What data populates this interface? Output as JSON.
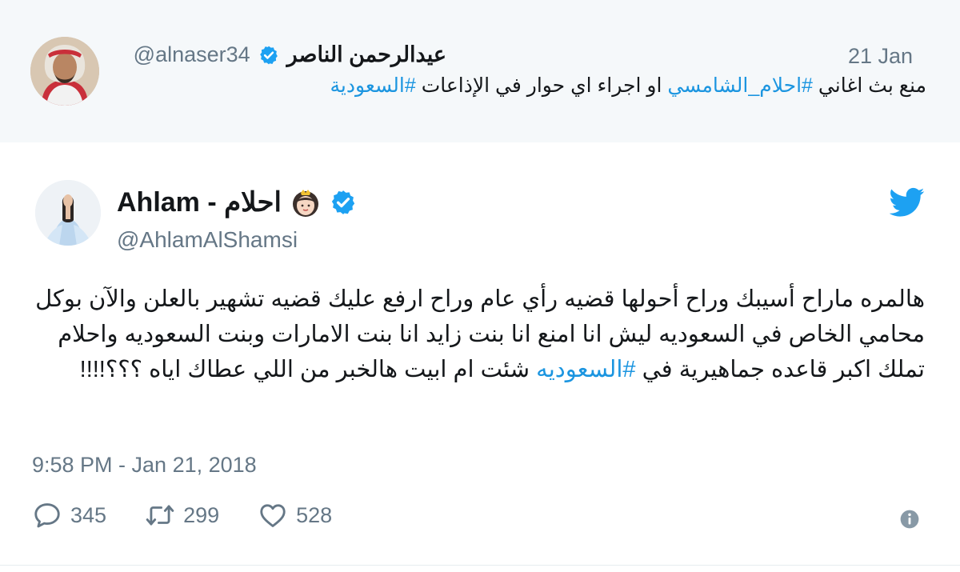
{
  "parent_tweet": {
    "name": "عيدالرحمن الناصر",
    "handle": "@alnaser34",
    "date": "21 Jan",
    "text_part1": "منع بث اغاني ",
    "hashtag1": "#احلام_الشامسي",
    "text_part2": " او اجراء اي حوار في الإذاعات ",
    "hashtag2": "#السعودية"
  },
  "main_tweet": {
    "name": "Ahlam - احلام",
    "handle": "@AhlamAlShamsi",
    "body_part1": "هالمره ماراح أسيبك وراح أحولها قضيه رأي عام وراح ارفع عليك قضيه تشهير بالعلن والآن بوكل محامي الخاص في السعوديه ليش انا امنع انا بنت زايد انا بنت الامارات وبنت السعوديه واحلام تملك اكبر قاعده جماهيرية في ",
    "body_hashtag": "#السعوديه",
    "body_part2": " شئت ام ابيت هالخبر من اللي عطاك اياه ؟؟؟!!!!",
    "timestamp": "9:58 PM - Jan 21, 2018",
    "replies": "345",
    "retweets": "299",
    "likes": "528"
  },
  "icons": {
    "verified": "verified-badge-icon",
    "bird": "twitter-bird-icon",
    "reply": "reply-icon",
    "retweet": "retweet-icon",
    "like": "heart-icon",
    "info": "info-icon",
    "emoji": "princess-emoji-icon"
  },
  "colors": {
    "accent": "#1da1f2",
    "hashtag": "#1b95e0",
    "muted": "#657786",
    "parent_bg": "#f5f8fa"
  }
}
